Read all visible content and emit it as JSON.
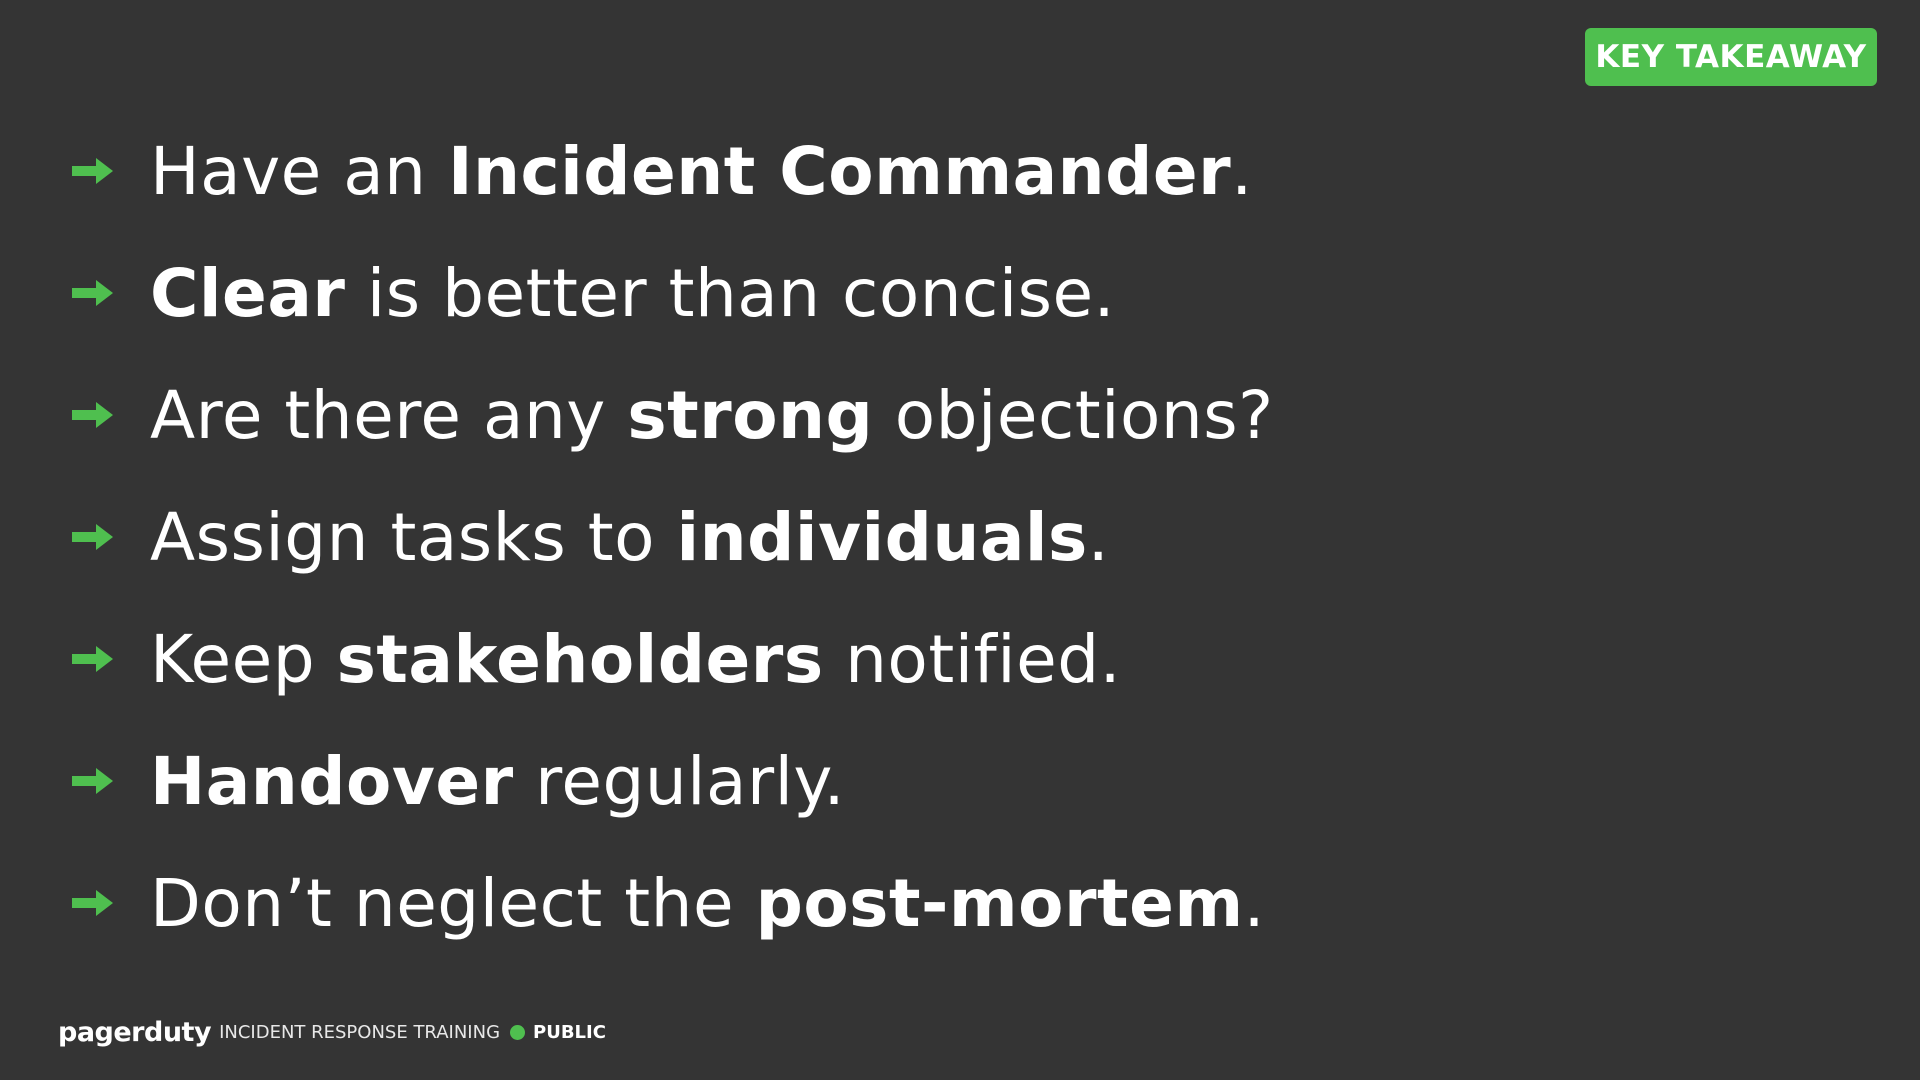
{
  "badge": {
    "label": "KEY TAKEAWAY",
    "color": "#4fbf4f"
  },
  "bullet_icon": "right-arrow-icon",
  "accent_color": "#4fbf4f",
  "background_color": "#343434",
  "bullets": [
    {
      "parts": [
        "Have an ",
        "Incident Commander",
        "."
      ]
    },
    {
      "parts": [
        "",
        "Clear",
        " is better than concise."
      ]
    },
    {
      "parts": [
        "Are there any ",
        "strong",
        " objections?"
      ]
    },
    {
      "parts": [
        "Assign tasks to ",
        "individuals",
        "."
      ]
    },
    {
      "parts": [
        "Keep ",
        "stakeholders",
        " notified."
      ]
    },
    {
      "parts": [
        "",
        "Handover",
        " regularly."
      ]
    },
    {
      "parts": [
        "Don’t neglect the ",
        "post-mortem",
        "."
      ]
    }
  ],
  "footer": {
    "logo": "pagerduty",
    "title": "INCIDENT RESPONSE TRAINING",
    "classification": "PUBLIC"
  }
}
